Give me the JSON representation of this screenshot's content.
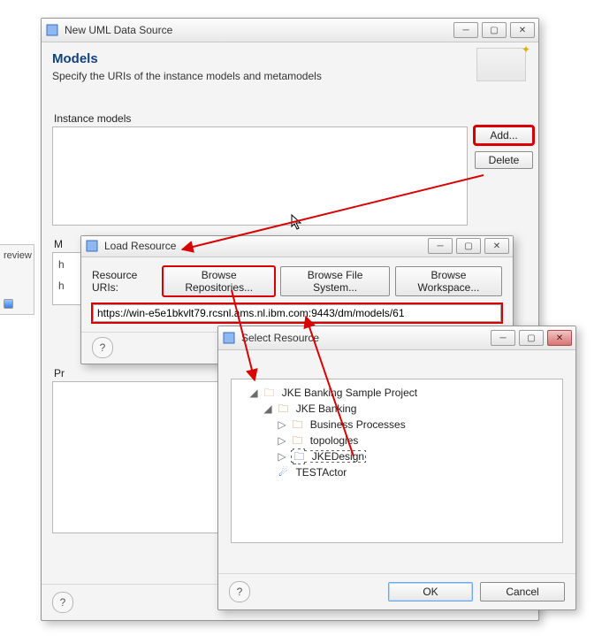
{
  "left_tab": {
    "label": "review"
  },
  "main": {
    "title": "New UML Data Source",
    "heading": "Models",
    "subheading": "Specify the URIs of the instance models and metamodels",
    "instance_label": "Instance models",
    "add_label": "Add...",
    "delete_label": "Delete",
    "m_label": "M",
    "row1_prefix": "h",
    "row2_prefix": "h",
    "pr_label": "Pr"
  },
  "load": {
    "title": "Load Resource",
    "uris_label": "Resource URIs:",
    "browse_repos_label": "Browse Repositories...",
    "browse_fs_label": "Browse File System...",
    "browse_ws_label": "Browse Workspace...",
    "uri_value": "https://win-e5e1bkvlt79.rcsnl.ams.nl.ibm.com:9443/dm/models/61"
  },
  "select": {
    "title": "Select Resource",
    "ok_label": "OK",
    "cancel_label": "Cancel",
    "tree": {
      "root": "JKE Banking Sample Project",
      "folder": "JKE Banking",
      "child1": "Business Processes",
      "child2": "topologies",
      "child3": "JKEDesign",
      "actor": "TESTActor"
    }
  }
}
